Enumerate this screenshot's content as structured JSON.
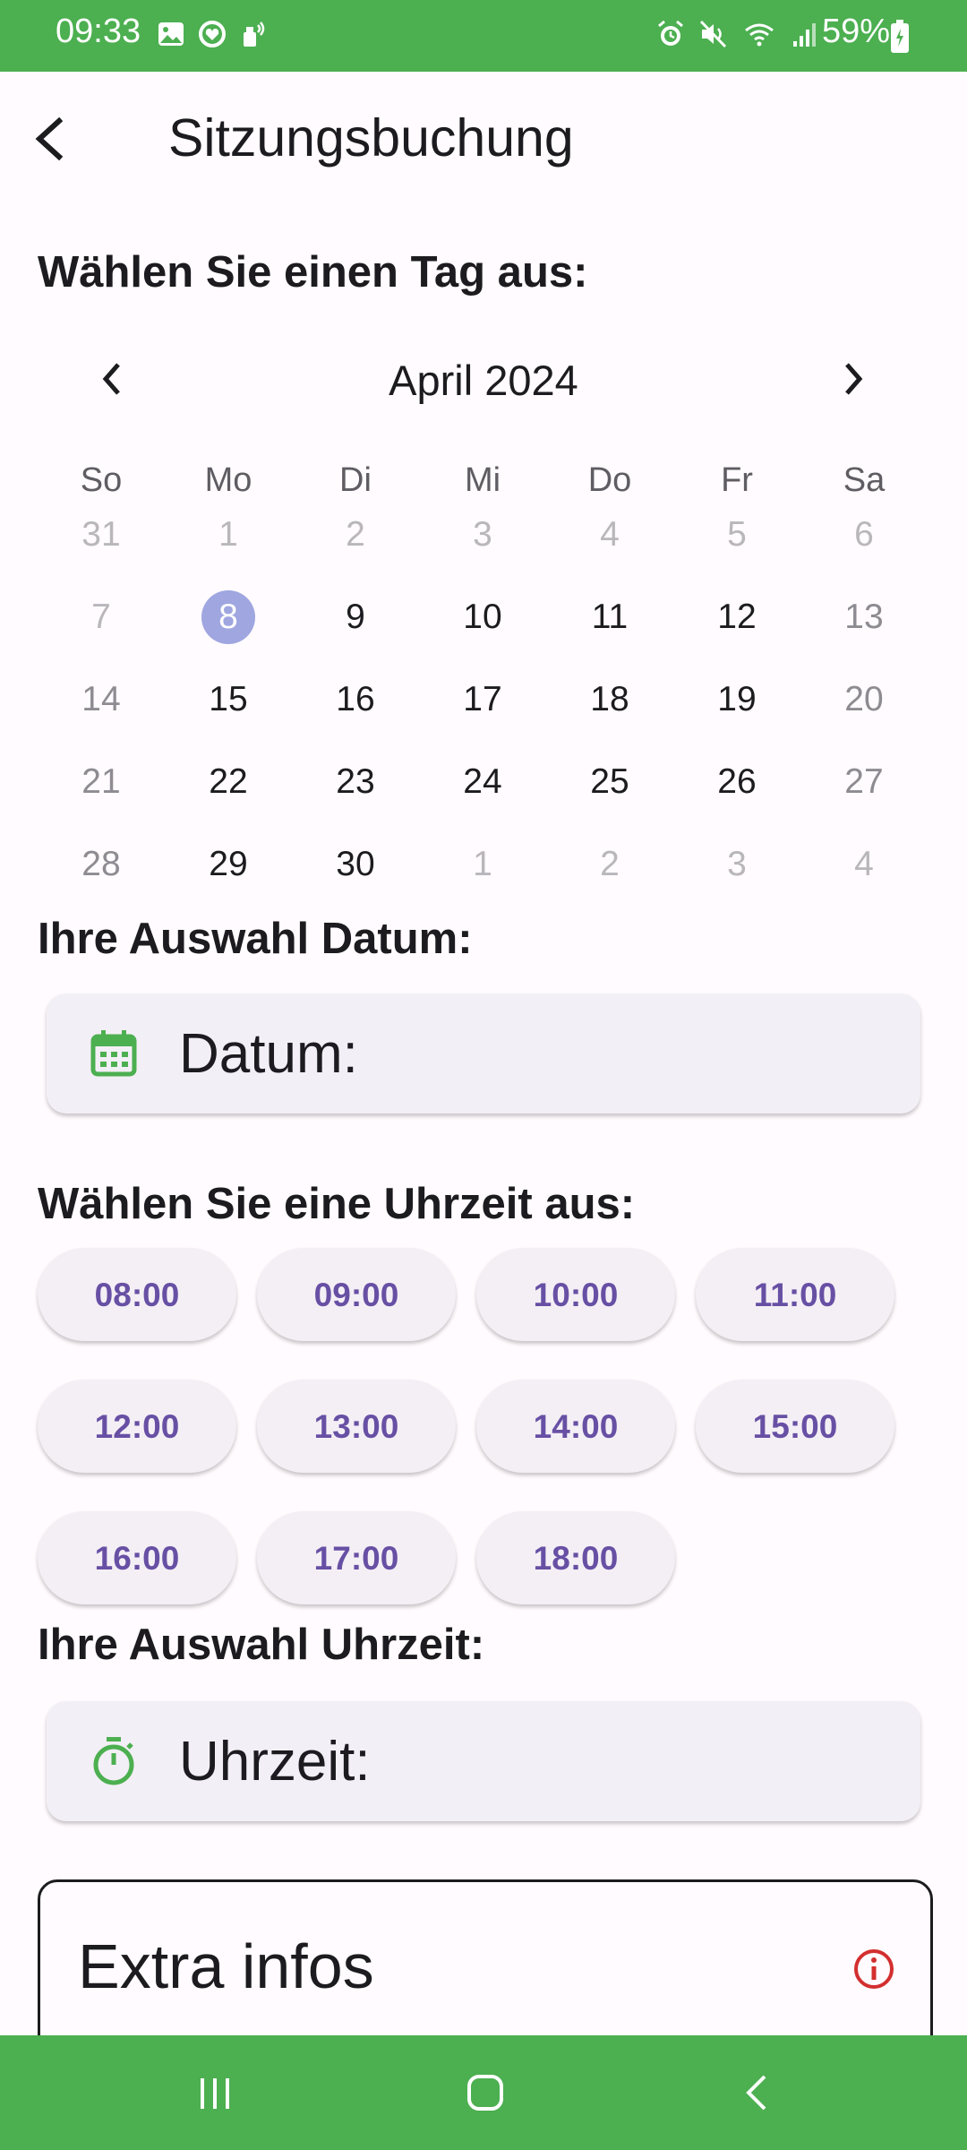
{
  "status_bar": {
    "time": "09:33",
    "battery": "59%",
    "left_icons": [
      "image-icon",
      "heart-app-icon",
      "notification-icon"
    ],
    "right_icons": [
      "alarm-icon",
      "mute-icon",
      "wifi-icon",
      "signal-icon",
      "battery-icon"
    ],
    "color": "#4caf50"
  },
  "app_bar": {
    "title": "Sitzungsbuchung",
    "back_icon": "back-arrow-icon"
  },
  "calendar": {
    "heading": "Wählen Sie einen Tag aus:",
    "month_label": "April 2024",
    "weekdays": [
      "So",
      "Mo",
      "Di",
      "Mi",
      "Do",
      "Fr",
      "Sa"
    ],
    "weeks": [
      [
        "31",
        "1",
        "2",
        "3",
        "4",
        "5",
        "6"
      ],
      [
        "7",
        "8",
        "9",
        "10",
        "11",
        "12",
        "13"
      ],
      [
        "14",
        "15",
        "16",
        "17",
        "18",
        "19",
        "20"
      ],
      [
        "21",
        "22",
        "23",
        "24",
        "25",
        "26",
        "27"
      ],
      [
        "28",
        "29",
        "30",
        "1",
        "2",
        "3",
        "4"
      ]
    ],
    "selected_day": "8",
    "selected_color": "#9fa6e0"
  },
  "date_selection": {
    "heading": "Ihre Auswahl Datum:",
    "label": "Datum:",
    "icon": "calendar-icon"
  },
  "time_selection": {
    "heading": "Wählen Sie eine Uhrzeit aus:",
    "slots": [
      "08:00",
      "09:00",
      "10:00",
      "11:00",
      "12:00",
      "13:00",
      "14:00",
      "15:00",
      "16:00",
      "17:00",
      "18:00"
    ]
  },
  "time_result": {
    "heading": "Ihre Auswahl Uhrzeit:",
    "label": "Uhrzeit:",
    "icon": "timer-icon"
  },
  "extra_info": {
    "title": "Extra infos",
    "icon": "info-icon",
    "icon_color": "#d32f2f"
  },
  "nav_bar": {
    "buttons": [
      "recent-apps-icon",
      "home-icon",
      "back-icon"
    ],
    "color": "#4caf50"
  }
}
